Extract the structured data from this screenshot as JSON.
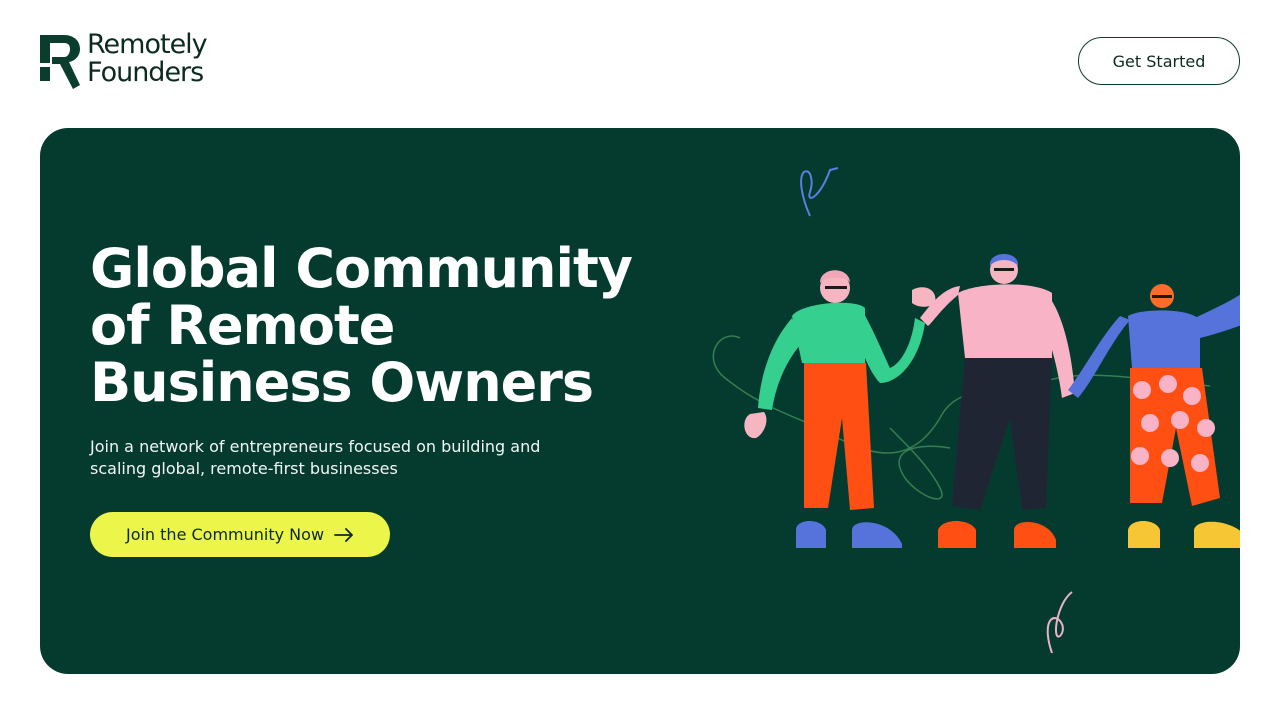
{
  "brand": {
    "line1": "Remotely",
    "line2": "Founders",
    "color": "#0b3d2e"
  },
  "header": {
    "cta_label": "Get Started"
  },
  "hero": {
    "title_lines": [
      "Global Community",
      "of Remote",
      "Business Owners"
    ],
    "subtitle": "Join a network of entrepreneurs focused on building and scaling global, remote-first businesses",
    "cta_label": "Join the Community Now",
    "cta_icon": "arrow-right-icon",
    "background": "#053b2e",
    "cta_color": "#ecf54a"
  }
}
